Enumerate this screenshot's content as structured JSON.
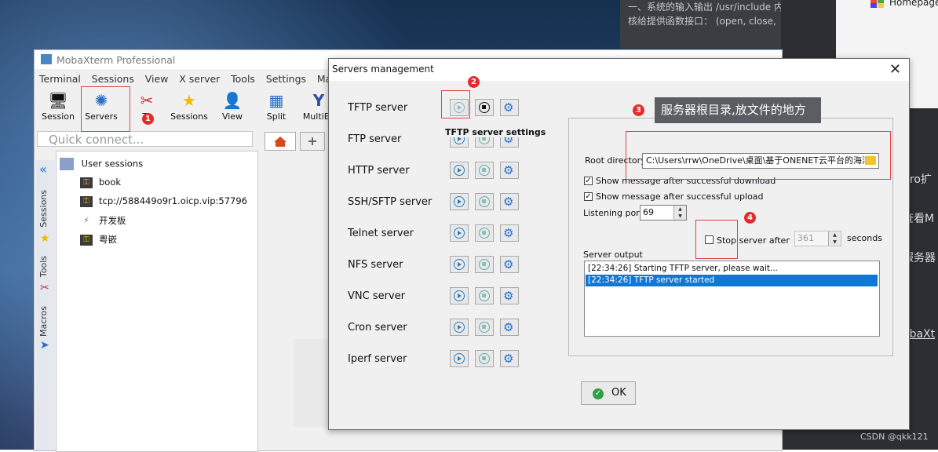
{
  "background": {
    "dark_panel_lines": [
      "一、系统的输入输出 /usr/include 内",
      "核给提供函数接口： (open, close,"
    ],
    "homepage": "Homepage",
    "right_fragments": [
      "pro扩",
      "查看M",
      "服务器",
      "obaXt"
    ],
    "csdn": "CSDN @qkk121"
  },
  "moba": {
    "title": "MobaXterm Professional",
    "menu": [
      "Terminal",
      "Sessions",
      "View",
      "X server",
      "Tools",
      "Settings",
      "Macro"
    ],
    "toolbar": [
      {
        "label": "Session",
        "icon": "session-icon"
      },
      {
        "label": "Servers",
        "icon": "servers-icon"
      },
      {
        "label": "To",
        "icon": "tools-icon"
      },
      {
        "label": "Sessions",
        "icon": "star-icon"
      },
      {
        "label": "View",
        "icon": "view-icon"
      },
      {
        "label": "Split",
        "icon": "split-icon"
      },
      {
        "label": "MultiEx",
        "icon": "multiexec-icon"
      }
    ],
    "quick_connect_placeholder": "Quick connect...",
    "side_tabs": [
      "Sessions",
      "Tools",
      "Macros"
    ],
    "user_sessions_label": "User sessions",
    "sessions": [
      "book",
      "tcp://588449o9r1.oicp.vip:57796",
      "开发板",
      "粤嵌"
    ]
  },
  "annotations": [
    "1",
    "2",
    "3",
    "4"
  ],
  "tooltip": "服务器根目录,放文件的地方",
  "dialog": {
    "title": "Servers management",
    "servers": [
      "TFTP server",
      "FTP server",
      "HTTP server",
      "SSH/SFTP server",
      "Telnet server",
      "NFS server",
      "VNC server",
      "Cron server",
      "Iperf server"
    ],
    "settings_title": "TFTP server settings",
    "root_dir_label": "Root directory",
    "root_dir_value": "C:\\Users\\rrw\\OneDrive\\桌面\\基于ONENET云平台的海洋",
    "show_download": "Show message after successful download",
    "show_upload": "Show message after successful upload",
    "listening_port_label": "Listening port",
    "listening_port": "69",
    "stop_server_label": "Stop server after",
    "stop_after_value": "361",
    "seconds_label": "seconds",
    "server_output_label": "Server output",
    "output_lines": [
      "[22:34:26] Starting TFTP server, please wait...",
      "[22:34:26] TFTP server started"
    ],
    "ok_label": "OK",
    "close_glyph": "✕"
  }
}
